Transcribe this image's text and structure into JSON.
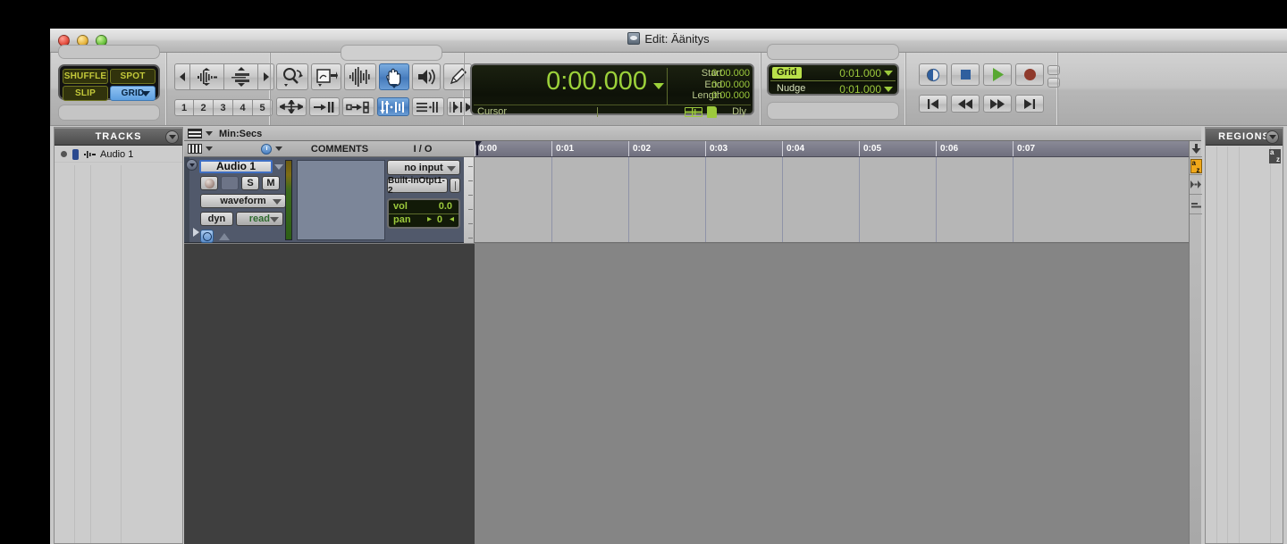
{
  "window": {
    "title": "Edit: Äänitys",
    "title_icon": "pro-tools-session-icon",
    "traffic_lights": [
      "close",
      "minimize",
      "zoom"
    ]
  },
  "toolbar": {
    "edit_modes": [
      {
        "label": "SHUFFLE",
        "active": false
      },
      {
        "label": "SPOT",
        "active": false
      },
      {
        "label": "SLIP",
        "active": false
      },
      {
        "label": "GRID",
        "active": true
      }
    ],
    "zoom_preset_buttons": [
      "1",
      "2",
      "3",
      "4",
      "5"
    ],
    "zoom_nav": [
      "zoom-out-arrow-left",
      "waveform-zoom",
      "track-height-zoom",
      "zoom-in-arrow-right"
    ],
    "tools": [
      {
        "name": "zoomer-tool",
        "active": false
      },
      {
        "name": "trim-tool",
        "active": false
      },
      {
        "name": "selector-tool",
        "active": false
      },
      {
        "name": "grabber-hand-tool",
        "active": true
      },
      {
        "name": "scrubber-tool",
        "active": false
      },
      {
        "name": "pencil-tool",
        "active": false
      }
    ],
    "edit_tools_row2": [
      {
        "name": "tab-to-transient",
        "active": false
      },
      {
        "name": "link-timeline-edit",
        "active": false
      },
      {
        "name": "link-track-edit",
        "active": false
      },
      {
        "name": "mirror-midi-edit",
        "active": true
      },
      {
        "name": "insertion-follows-playback",
        "active": false
      },
      {
        "name": "auto-scroll",
        "active": false
      }
    ]
  },
  "counter": {
    "main_time": "0:00.000",
    "dropdown_icon": "chevron-down-icon",
    "selection_labels": [
      "Start",
      "End",
      "Length"
    ],
    "selection_values": [
      "0:00.000",
      "0:00.000",
      "0:00.000"
    ],
    "cursor_label": "Cursor",
    "dly_label": "Dly",
    "icons": [
      "timeline-insertion-icon",
      "session-start-icon"
    ]
  },
  "grid_nudge": {
    "grid_label": "Grid",
    "grid_value": "0:01.000",
    "nudge_label": "Nudge",
    "nudge_value": "0:01.000"
  },
  "transport": {
    "top_row": [
      {
        "name": "return-to-zero-loop-button",
        "icon": "online-globe-icon"
      },
      {
        "name": "stop-button",
        "icon": "stop-square-icon"
      },
      {
        "name": "play-button",
        "icon": "play-triangle-icon"
      },
      {
        "name": "record-button",
        "icon": "record-circle-icon"
      }
    ],
    "bottom_row": [
      {
        "name": "return-to-zero-button",
        "icon": "skip-to-start-icon"
      },
      {
        "name": "rewind-button",
        "icon": "rewind-icon"
      },
      {
        "name": "fast-forward-button",
        "icon": "fast-forward-icon"
      },
      {
        "name": "go-to-end-button",
        "icon": "skip-to-end-icon"
      }
    ],
    "mini_buttons": [
      "transport-mini-top",
      "transport-mini-bottom"
    ]
  },
  "tracks_panel": {
    "header": "TRACKS",
    "rows": [
      {
        "name": "Audio 1"
      }
    ]
  },
  "regions_panel": {
    "header": "REGIONS",
    "sort_icon": "a-to-z-sort-icon"
  },
  "edit_window": {
    "ruler_name": "Min:Secs",
    "column_headers": [
      "COMMENTS",
      "I / O"
    ],
    "timeline_ticks": [
      "0:00",
      "0:01",
      "0:02",
      "0:03",
      "0:04",
      "0:05",
      "0:06",
      "0:07"
    ],
    "rail": {
      "scroll_icon": "scroll-down-icon",
      "sort_icon": "a-to-z-sort-icon",
      "nudge_icon": "nudge-right-icon",
      "zoom_icon": "horizontal-zoom-icon"
    }
  },
  "track": {
    "name": "Audio 1",
    "record_enable": "record-arm-button",
    "solo": "S",
    "mute": "M",
    "view_selector": "waveform",
    "dyn_button": "dyn",
    "automation_mode": "read",
    "input": "no input",
    "output": "Built-inOtpt1-2",
    "vol_label": "vol",
    "vol_value": "0.0",
    "pan_label": "pan",
    "pan_value": "0"
  },
  "colors": {
    "accent_blue": "#4a7fc0",
    "lcd_green": "#9cc93c",
    "lcd_background": "#121a08",
    "track_strip_blue": "#51596b",
    "sort_orange": "#f0a81a",
    "panel_header_grey": "#4b4b4b"
  }
}
